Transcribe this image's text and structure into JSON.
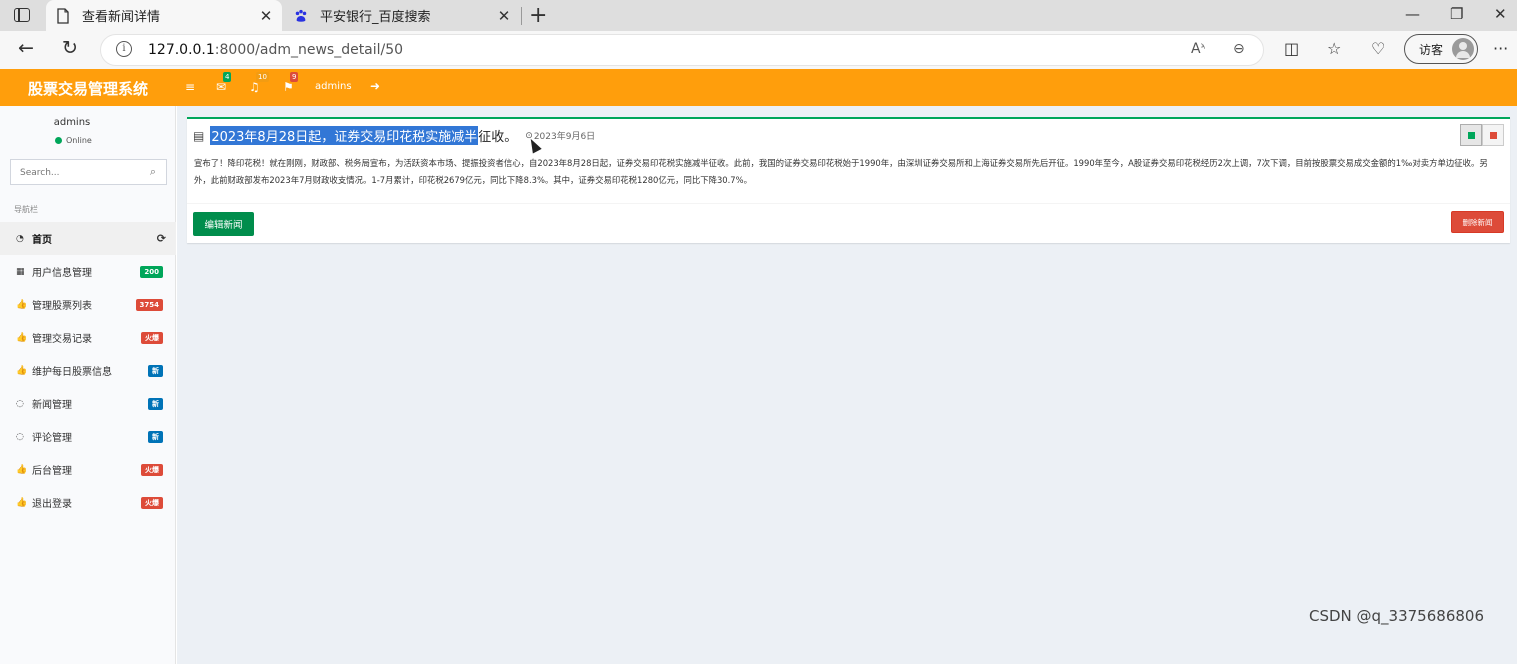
{
  "browser": {
    "tabs": [
      {
        "title": "查看新闻详情",
        "close": "✕",
        "icon": "page-icon"
      },
      {
        "title": "平安银行_百度搜索",
        "close": "✕",
        "icon": "baidu-paw-icon"
      }
    ],
    "new_tab": "+",
    "window_controls": {
      "minimize": "—",
      "restore": "❐",
      "close": "✕"
    },
    "url_host": "127.0.0.1",
    "url_rest": ":8000/adm_news_detail/50",
    "guest_label": "访客",
    "more": "···"
  },
  "app": {
    "brand": "股票交易管理系统",
    "accent_color": "#ff9e0c",
    "header": {
      "menu_toggle": "≡",
      "mail_badge": "4",
      "bell_badge": "10",
      "flag_badge": "9",
      "username": "admins",
      "logout_icon": "sign-out-icon"
    }
  },
  "sidebar": {
    "username": "admins",
    "status": "Online",
    "search_placeholder": "Search...",
    "header": "导航栏",
    "items": [
      {
        "label": "首页",
        "icon": "dashboard-icon",
        "active": true,
        "badge": null
      },
      {
        "label": "用户信息管理",
        "icon": "grid-icon",
        "badge": "200",
        "badge_color": "#00a65a"
      },
      {
        "label": "管理股票列表",
        "icon": "thumbs-up-icon",
        "badge": "3754",
        "badge_color": "#dd4b39"
      },
      {
        "label": "管理交易记录",
        "icon": "thumbs-up-icon",
        "badge": "火爆",
        "badge_color": "#dd4b39"
      },
      {
        "label": "维护每日股票信息",
        "icon": "thumbs-up-icon",
        "badge": "新",
        "badge_color": "#0073b7"
      },
      {
        "label": "新闻管理",
        "icon": "comment-icon",
        "badge": "新",
        "badge_color": "#0073b7"
      },
      {
        "label": "评论管理",
        "icon": "comment-icon",
        "badge": "新",
        "badge_color": "#0073b7"
      },
      {
        "label": "后台管理",
        "icon": "thumbs-up-icon",
        "badge": "火爆",
        "badge_color": "#dd4b39"
      },
      {
        "label": "退出登录",
        "icon": "thumbs-up-icon",
        "badge": "火爆",
        "badge_color": "#dd4b39"
      }
    ]
  },
  "news": {
    "title_selected": "2023年8月28日起，证券交易印花税实施减半",
    "title_rest": "征收。",
    "date": "2023年9月6日",
    "body": "宣布了！降印花税！就在刚刚，财政部、税务局宣布，为活跃资本市场、提振投资者信心，自2023年8月28日起，证券交易印花税实施减半征收。此前，我国的证券交易印花税始于1990年，由深圳证券交易所和上海证券交易所先后开征。1990年至今，A股证券交易印花税经历2次上调，7次下调，目前按股票交易成交金额的1‰对卖方单边征收。另外，此前财政部发布2023年7月财政收支情况。1-7月累计，印花税2679亿元，同比下降8.3%。其中，证券交易印花税1280亿元，同比下降30.7%。",
    "edit_button": "编辑新闻",
    "delete_button": "删除新闻"
  },
  "watermark": "CSDN @q_3375686806"
}
